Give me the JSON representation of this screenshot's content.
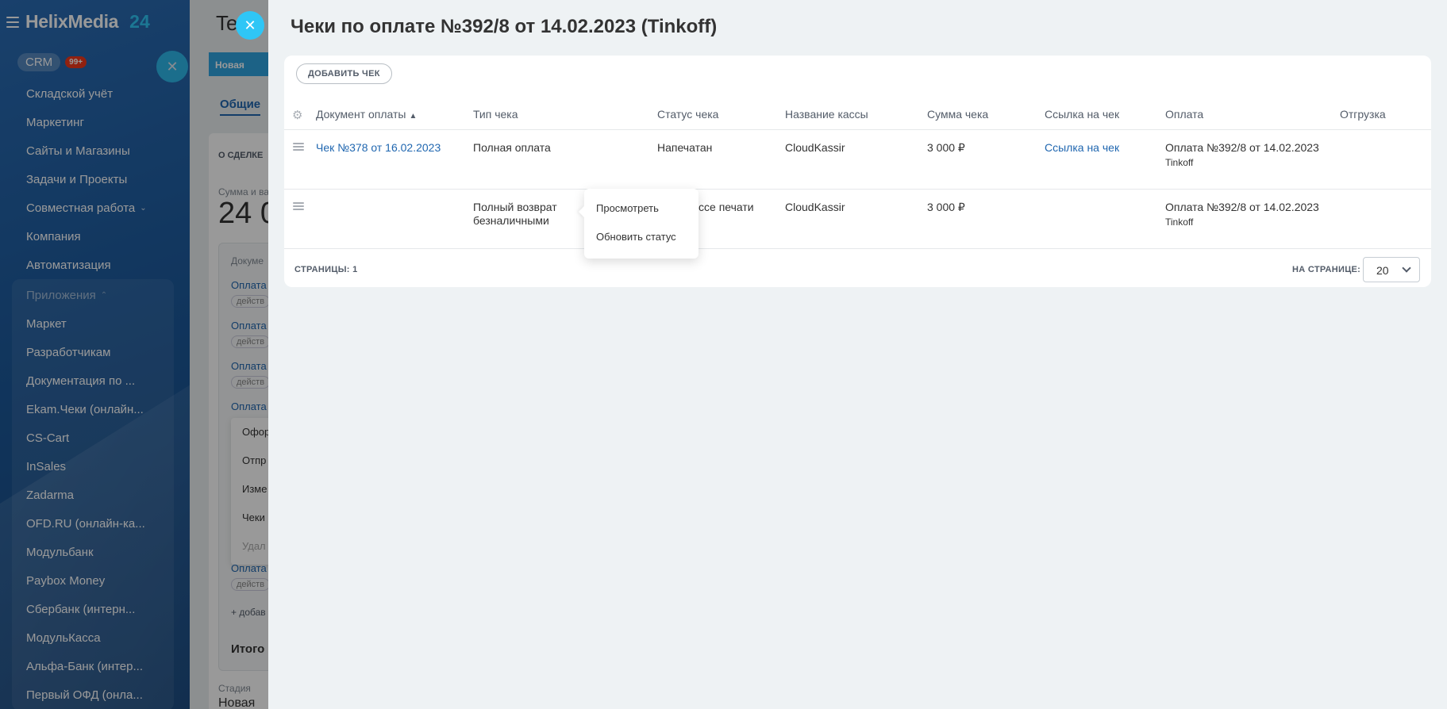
{
  "app": {
    "brand_name": "HelixMedia",
    "brand_number": "24"
  },
  "sidebar": {
    "crm_label": "CRM",
    "crm_badge": "99+",
    "items": [
      {
        "label": "Складской учёт"
      },
      {
        "label": "Маркетинг"
      },
      {
        "label": "Сайты и Магазины"
      },
      {
        "label": "Задачи и Проекты"
      },
      {
        "label": "Совместная работа"
      },
      {
        "label": "Компания"
      },
      {
        "label": "Автоматизация"
      }
    ],
    "apps_header": "Приложения",
    "apps": [
      {
        "label": "Маркет"
      },
      {
        "label": "Разработчикам"
      },
      {
        "label": "Документация по ..."
      },
      {
        "label": "Ekam.Чеки (онлайн..."
      },
      {
        "label": "CS-Cart"
      },
      {
        "label": "InSales"
      },
      {
        "label": "Zadarma"
      },
      {
        "label": "OFD.RU (онлайн-ка..."
      },
      {
        "label": "Модульбанк"
      },
      {
        "label": "Paybox Money"
      },
      {
        "label": "Сбербанк (интерн..."
      },
      {
        "label": "МодульКасса"
      },
      {
        "label": "Альфа-Банк (интер..."
      },
      {
        "label": "Первый ОФД (онла..."
      }
    ]
  },
  "deal": {
    "title_fragment": "Te",
    "stage_chip": "Новая",
    "tab_general": "Общие",
    "section_label": "О СДЕЛКЕ",
    "sum_label": "Сумма и ва",
    "sum_value": "24 0",
    "docs_label": "Докуме",
    "payment_links": [
      "Оплата",
      "Оплата",
      "Оплата",
      "Оплата",
      "Оплата"
    ],
    "payment_tags": [
      "действ",
      "действ",
      "действ",
      "действ"
    ],
    "menu_items": [
      "Офор",
      "Отпр",
      "Изме",
      "Чеки",
      "Удал"
    ],
    "add_link": "+ добав",
    "total_label": "Итого к",
    "stage_label": "Стадия",
    "stage_value": "Новая"
  },
  "slider": {
    "title": "Чеки по оплате №392/8 от 14.02.2023 (Tinkoff)",
    "add_button": "ДОБАВИТЬ ЧЕК",
    "columns": {
      "doc": "Документ оплаты",
      "type": "Тип чека",
      "status": "Статус чека",
      "register": "Название кассы",
      "amount": "Сумма чека",
      "link": "Ссылка на чек",
      "payment": "Оплата",
      "shipment": "Отгрузка"
    },
    "rows": [
      {
        "doc": "Чек №378 от 16.02.2023",
        "type": "Полная оплата",
        "status": "Напечатан",
        "register": "CloudKassir",
        "amount": "3 000 ₽",
        "link": "Ссылка на чек",
        "payment": "Оплата №392/8 от 14.02.2023",
        "payment_system": "Tinkoff",
        "shipment": ""
      },
      {
        "doc": "",
        "type": "Полный возврат безналичными",
        "status": "В процессе печати",
        "register": "CloudKassir",
        "amount": "3 000 ₽",
        "link": "",
        "payment": "Оплата №392/8 от 14.02.2023",
        "payment_system": "Tinkoff",
        "shipment": ""
      }
    ],
    "pages_label": "СТРАНИЦЫ: 1",
    "per_page_label": "НА СТРАНИЦЕ:",
    "per_page_value": "20"
  },
  "popup": {
    "items": [
      "Просмотреть",
      "Обновить статус"
    ]
  },
  "colors": {
    "accent": "#2fc6f6",
    "link": "#2067b0",
    "sidebar": "#1d5a9c",
    "badge": "#f0371b"
  },
  "icons": {
    "close": "close-icon",
    "settings": "gear-icon",
    "drag": "drag-handle-icon",
    "sort": "sort-up-icon",
    "dropdown": "chevron-down-icon"
  }
}
